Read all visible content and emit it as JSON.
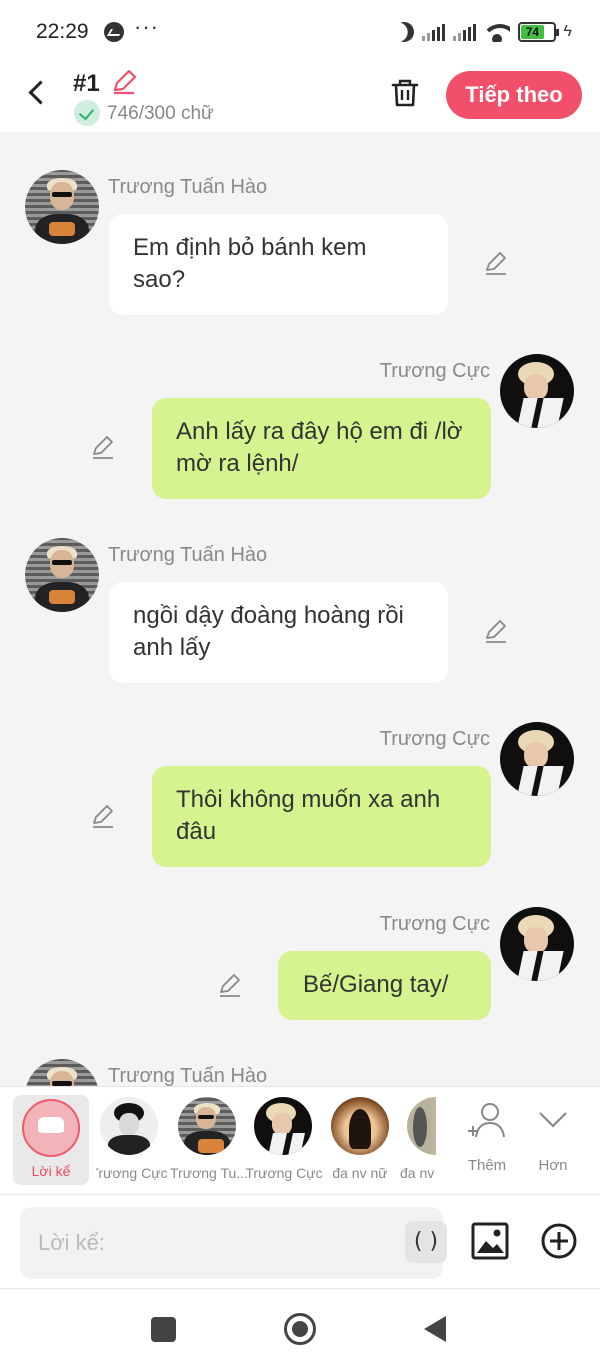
{
  "status_bar": {
    "time": "22:29",
    "icons": [
      "messenger-icon",
      "more-dots-icon",
      "moon-icon",
      "signal-icon",
      "wifi-icon",
      "battery-icon",
      "charging-icon"
    ],
    "more": "···",
    "battery_level": "74"
  },
  "header": {
    "title": "#1",
    "word_count": "746/300 chữ",
    "next_label": "Tiếp theo",
    "accent_color": "#f2506a"
  },
  "messages": [
    {
      "sender": "Trương Tuấn Hào",
      "side": "left",
      "text": "Em định bỏ bánh kem sao?"
    },
    {
      "sender": "Trương Cực",
      "side": "right",
      "text": "Anh lấy ra đây hộ em đi /lờ mờ ra lệnh/"
    },
    {
      "sender": "Trương Tuấn Hào",
      "side": "left",
      "text": "ngồi dậy đoàng hoàng rồi anh lấy"
    },
    {
      "sender": "Trương Cực",
      "side": "right",
      "text": "Thôi không muốn xa anh đâu"
    },
    {
      "sender": "Trương Cực",
      "side": "right",
      "text": "Bế/Giang tay/"
    },
    {
      "sender": "Trương Tuấn Hào",
      "side": "left",
      "text": ""
    }
  ],
  "character_bar": {
    "narration_label": "Lời kể",
    "characters": [
      "Trương Cực",
      "Trương Tu...",
      "Trương Cực",
      "đa nv nữ",
      "đa nv"
    ],
    "add_label": "Thêm",
    "more_label": "Hơn"
  },
  "input": {
    "placeholder": "Lời kể:",
    "paren_label": "( )"
  },
  "colors": {
    "bubble_green": "#d5f38e",
    "bubble_white": "#ffffff",
    "background": "#f4f4f4"
  }
}
